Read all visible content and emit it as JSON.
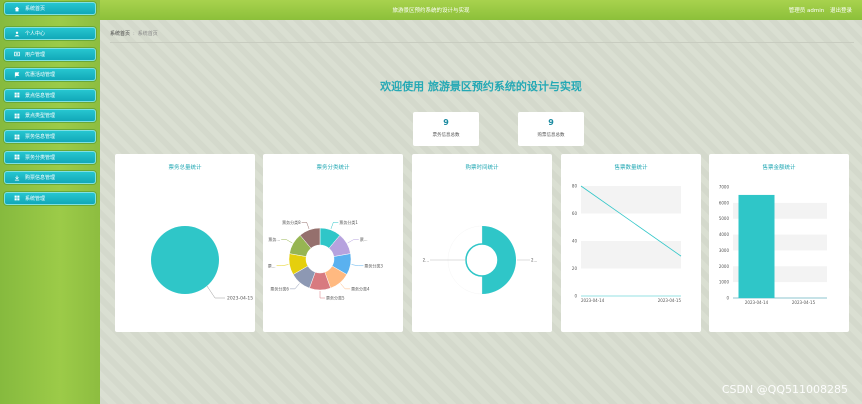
{
  "header": {
    "title": "旅游景区预约系统的设计与实现",
    "user_label": "管理员 admin",
    "logout_label": "退出登录"
  },
  "sidebar": {
    "home": {
      "label": "系统首页",
      "icon": "home-icon"
    },
    "items": [
      {
        "label": "个人中心",
        "icon": "user-icon"
      },
      {
        "label": "用户管理",
        "icon": "gear-icon"
      },
      {
        "label": "优惠活动管理",
        "icon": "flag-icon"
      },
      {
        "label": "景点信息管理",
        "icon": "grid-icon"
      },
      {
        "label": "景点类型管理",
        "icon": "grid-icon"
      },
      {
        "label": "票务信息管理",
        "icon": "grid-icon"
      },
      {
        "label": "票务分类管理",
        "icon": "grid-icon"
      },
      {
        "label": "购票信息管理",
        "icon": "download-icon"
      },
      {
        "label": "系统管理",
        "icon": "grid-icon"
      }
    ]
  },
  "breadcrumb": {
    "home": "系统首页",
    "separator": ":",
    "current": "系统首页"
  },
  "welcome": "欢迎使用 旅游景区预约系统的设计与实现",
  "stats": [
    {
      "value": "9",
      "label": "票务信息总数"
    },
    {
      "value": "9",
      "label": "购票信息总数"
    }
  ],
  "colors": {
    "accent": "#2fc6c8",
    "title": "#25a9b5",
    "topbar": "#9ccb48"
  },
  "chart_data": [
    {
      "type": "pie",
      "title": "票务总量统计",
      "labels": [
        "2023-04-15"
      ],
      "values": [
        9
      ]
    },
    {
      "type": "pie",
      "title": "票务分类统计",
      "labels": [
        "票务分类1",
        "票...",
        "票务分类3",
        "票务分类4",
        "票务分类5",
        "票务分类6",
        "票...",
        "票务...",
        "票务分类8"
      ],
      "values": [
        1,
        1,
        1,
        1,
        1,
        1,
        1,
        1,
        1
      ],
      "colors": [
        "#2fc6c8",
        "#b6a2de",
        "#5ab1ef",
        "#ffb980",
        "#d87a80",
        "#8d98b3",
        "#e5cf0d",
        "#97b552",
        "#95706d"
      ]
    },
    {
      "type": "pie",
      "title": "购票时间统计",
      "labels": [
        "2...",
        "2..."
      ],
      "values": [
        1,
        1
      ],
      "colors": [
        "#2fc6c8",
        "#ffffff"
      ]
    },
    {
      "type": "line",
      "title": "售票数量统计",
      "x": [
        "2023-04-14",
        "2023-04-15"
      ],
      "y": [
        80,
        29
      ],
      "yticks": [
        0,
        20,
        40,
        60,
        80
      ],
      "ylim": [
        0,
        80
      ]
    },
    {
      "type": "bar",
      "title": "售票金额统计",
      "categories": [
        "2023-04-14",
        "2023-04-15"
      ],
      "values": [
        6500,
        0
      ],
      "yticks": [
        0,
        1000,
        2000,
        3000,
        4000,
        5000,
        6000,
        7000
      ],
      "ylim": [
        0,
        7000
      ]
    }
  ],
  "watermark": "CSDN @QQ511008285"
}
